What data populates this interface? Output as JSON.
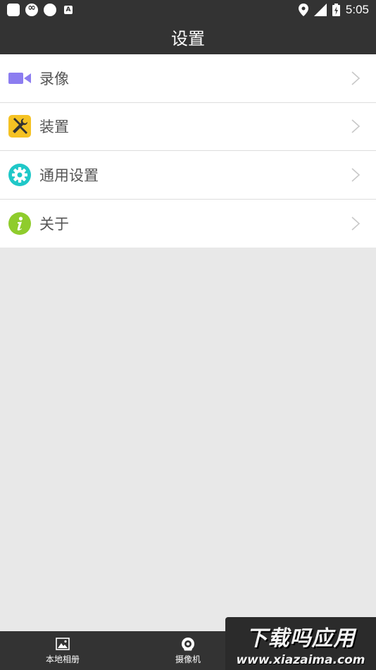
{
  "status_bar": {
    "time": "5:05",
    "left_icons": [
      "app-square-icon",
      "loop-icon",
      "circle-icon",
      "a-letter-icon"
    ],
    "a_letter": "A",
    "right_icons": [
      "location-icon",
      "signal-icon",
      "battery-charging-icon"
    ]
  },
  "app_bar": {
    "title": "设置"
  },
  "menu": {
    "items": [
      {
        "label": "录像",
        "icon": "video-camera-icon",
        "color": "#8c7df0"
      },
      {
        "label": "装置",
        "icon": "tools-icon",
        "color": "#f5c223"
      },
      {
        "label": "通用设置",
        "icon": "gear-icon",
        "color": "#1fc8c8"
      },
      {
        "label": "关于",
        "icon": "info-icon",
        "color": "#8fcc2c"
      }
    ]
  },
  "bottom_nav": {
    "items": [
      {
        "label": "本地相册",
        "icon": "image-icon"
      },
      {
        "label": "摄像机",
        "icon": "camera-icon"
      }
    ]
  },
  "watermark": {
    "title": "下载吗应用",
    "url": "www.xiazaima.com"
  }
}
